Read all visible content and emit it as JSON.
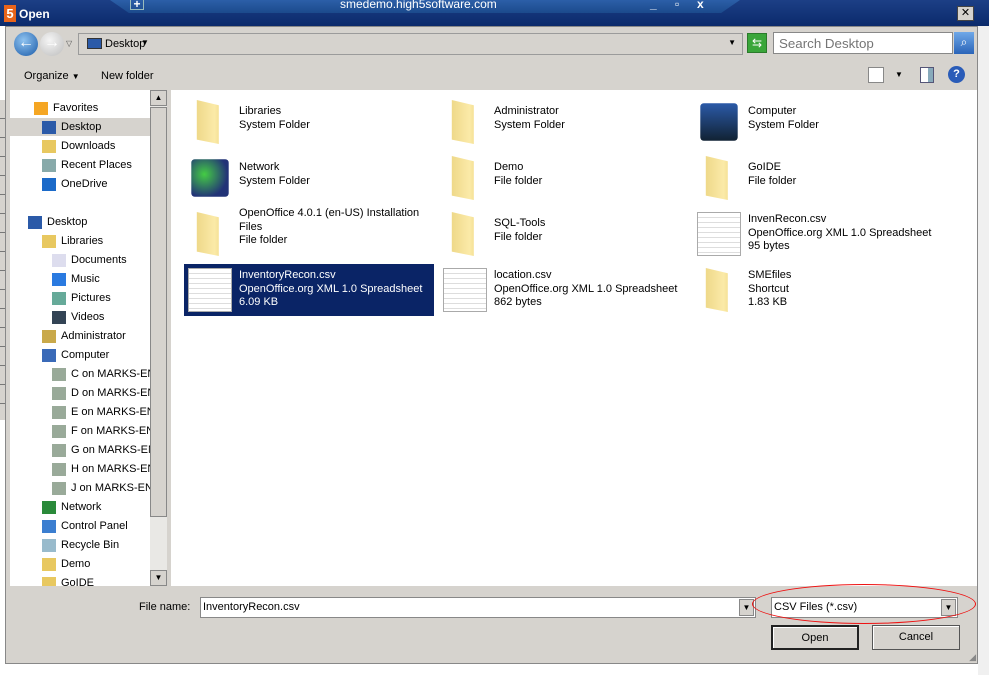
{
  "window": {
    "title": "Open",
    "remote_host": "smedemo.high5software.com",
    "logo": "5"
  },
  "address": {
    "location": "Desktop",
    "search_placeholder": "Search Desktop"
  },
  "toolbar": {
    "organize": "Organize",
    "new_folder": "New folder"
  },
  "sidebar": {
    "items": [
      {
        "label": "Favorites",
        "icon": "star-icon"
      },
      {
        "label": "Desktop",
        "icon": "desktop-icon",
        "selected": true
      },
      {
        "label": "Downloads",
        "icon": "downloads-icon"
      },
      {
        "label": "Recent Places",
        "icon": "recent-places-icon"
      },
      {
        "label": "OneDrive",
        "icon": "cloud-icon"
      },
      {
        "label": "Desktop",
        "icon": "desktop-icon"
      },
      {
        "label": "Libraries",
        "icon": "libraries-icon"
      },
      {
        "label": "Documents",
        "icon": "document-icon"
      },
      {
        "label": "Music",
        "icon": "music-icon"
      },
      {
        "label": "Pictures",
        "icon": "pictures-icon"
      },
      {
        "label": "Videos",
        "icon": "videos-icon"
      },
      {
        "label": "Administrator",
        "icon": "user-folder-icon"
      },
      {
        "label": "Computer",
        "icon": "computer-icon"
      },
      {
        "label": "C on MARKS-ENV",
        "icon": "network-drive-icon"
      },
      {
        "label": "D on MARKS-ENV",
        "icon": "network-drive-icon"
      },
      {
        "label": "E on MARKS-ENV",
        "icon": "network-drive-icon"
      },
      {
        "label": "F on MARKS-ENV",
        "icon": "network-drive-icon"
      },
      {
        "label": "G on MARKS-ENV",
        "icon": "network-drive-icon"
      },
      {
        "label": "H on MARKS-ENV",
        "icon": "network-drive-icon"
      },
      {
        "label": "J on MARKS-ENV",
        "icon": "network-drive-icon"
      },
      {
        "label": "Network",
        "icon": "network-icon"
      },
      {
        "label": "Control Panel",
        "icon": "control-panel-icon"
      },
      {
        "label": "Recycle Bin",
        "icon": "recycle-bin-icon"
      },
      {
        "label": "Demo",
        "icon": "folder-icon"
      },
      {
        "label": "GoIDE",
        "icon": "folder-icon"
      }
    ]
  },
  "files": [
    {
      "name": "Libraries",
      "type": "System Folder",
      "size": "",
      "icon": "libraries-icon"
    },
    {
      "name": "Administrator",
      "type": "System Folder",
      "size": "",
      "icon": "user-folder-icon"
    },
    {
      "name": "Computer",
      "type": "System Folder",
      "size": "",
      "icon": "computer-icon"
    },
    {
      "name": "Network",
      "type": "System Folder",
      "size": "",
      "icon": "network-icon"
    },
    {
      "name": "Demo",
      "type": "File folder",
      "size": "",
      "icon": "folder-icon"
    },
    {
      "name": "GoIDE",
      "type": "File folder",
      "size": "",
      "icon": "folder-icon"
    },
    {
      "name": "OpenOffice 4.0.1 (en-US) Installation Files",
      "type": "File folder",
      "size": "",
      "icon": "folder-icon"
    },
    {
      "name": "SQL-Tools",
      "type": "File folder",
      "size": "",
      "icon": "folder-icon"
    },
    {
      "name": "InvenRecon.csv",
      "type": "OpenOffice.org XML 1.0 Spreadsheet",
      "size": "95 bytes",
      "icon": "spreadsheet-icon"
    },
    {
      "name": "InventoryRecon.csv",
      "type": "OpenOffice.org XML 1.0 Spreadsheet",
      "size": "6.09 KB",
      "icon": "spreadsheet-icon",
      "selected": true
    },
    {
      "name": "location.csv",
      "type": "OpenOffice.org XML 1.0 Spreadsheet",
      "size": "862 bytes",
      "icon": "spreadsheet-icon"
    },
    {
      "name": "SMEfiles",
      "type": "Shortcut",
      "size": "1.83 KB",
      "icon": "folder-shortcut-icon"
    }
  ],
  "footer": {
    "file_name_label": "File name:",
    "file_name": "InventoryRecon.csv",
    "filter": "CSV Files (*.csv)",
    "open": "Open",
    "cancel": "Cancel"
  },
  "annotation_color": "#e11111",
  "selection_color": "#0a2466"
}
